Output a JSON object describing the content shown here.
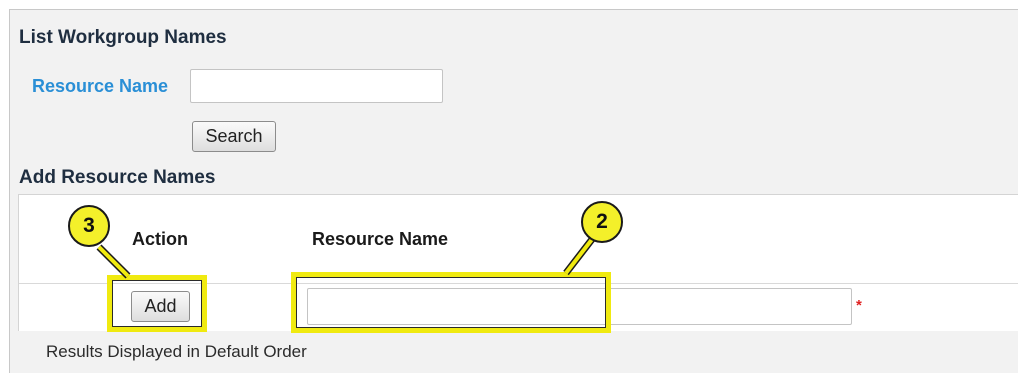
{
  "list_section": {
    "heading": "List Workgroup Names",
    "resource_label": "Resource Name",
    "resource_value": "",
    "search_button": "Search"
  },
  "add_section": {
    "heading": "Add Resource Names",
    "columns": [
      "Action",
      "Resource Name"
    ],
    "add_button": "Add",
    "resource_value": "",
    "required_marker": "*"
  },
  "footer": {
    "results_text": "Results Displayed in Default Order"
  },
  "callouts": [
    "2",
    "3"
  ],
  "colors": {
    "highlight": "#f0ea10",
    "label_blue": "#2a8fd6",
    "required": "#e02020"
  }
}
